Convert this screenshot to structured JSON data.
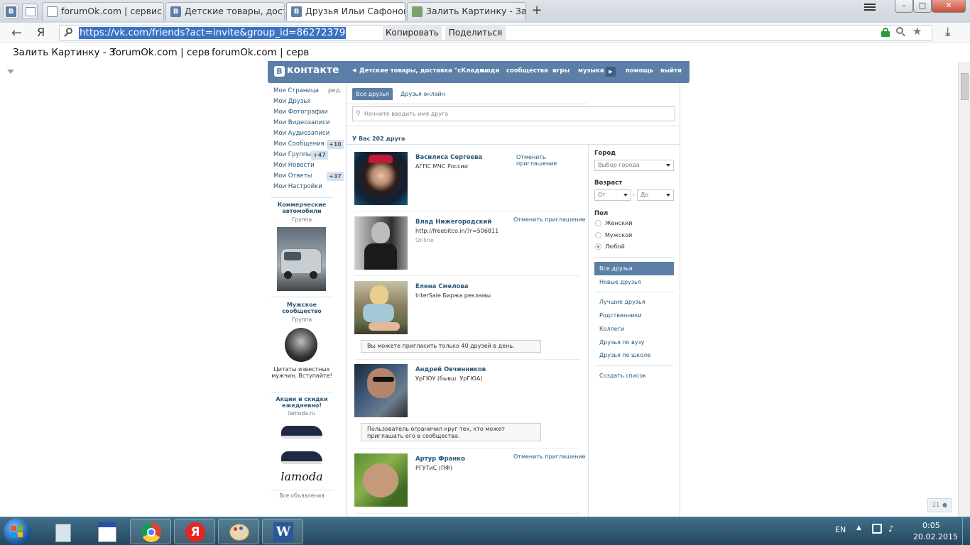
{
  "browser": {
    "tabs": [
      {
        "label": "forumOk.com | сервис",
        "active": false,
        "favicon": "doc"
      },
      {
        "label": "Детские товары, доставк",
        "active": false,
        "favicon": "vk"
      },
      {
        "label": "Друзья Ильи Сафонова",
        "active": true,
        "favicon": "vk"
      },
      {
        "label": "Залить Картинку - За",
        "active": false,
        "favicon": "img"
      }
    ],
    "pinned_tab_icons": [
      "vk-icon",
      "ru-icon"
    ],
    "new_tab_label": "+",
    "window_controls": {
      "minimize": "–",
      "maximize": "□",
      "close": "✕"
    },
    "yandex_label": "Я",
    "url": "https://vk.com/friends?act=invite&group_id=86272379",
    "copy_button": "Копировать",
    "share_button": "Поделиться",
    "bookmarks": [
      "Залить Картинку - З",
      "forumOk.com | серв",
      "forumOk.com | серв"
    ]
  },
  "vk": {
    "logo_letter": "В",
    "logo_text": "контакте",
    "nav": {
      "group": "Детские товары, доставка \"сКлади...",
      "people": "люди",
      "communities": "сообщества",
      "games": "игры",
      "music": "музыка",
      "help": "помощь",
      "logout": "выйти"
    },
    "left_menu": [
      {
        "label": "Моя Страница",
        "extra": "ред."
      },
      {
        "label": "Мои Друзья",
        "extra": ""
      },
      {
        "label": "Мои Фотографии",
        "extra": ""
      },
      {
        "label": "Мои Видеозаписи",
        "extra": ""
      },
      {
        "label": "Мои Аудиозаписи",
        "extra": ""
      },
      {
        "label": "Мои Сообщения",
        "extra": "+10"
      },
      {
        "label": "Мои Группы",
        "extra": "+47"
      },
      {
        "label": "Мои Новости",
        "extra": ""
      },
      {
        "label": "Мои Ответы",
        "extra": "+37"
      },
      {
        "label": "Мои Настройки",
        "extra": ""
      }
    ],
    "ads": [
      {
        "title": "Коммерческие автомобили",
        "sub": "Группа"
      },
      {
        "title": "Мужское сообщество",
        "sub": "Группа",
        "text": "Цитаты известных мужчин. Вступайте!"
      },
      {
        "title": "Акции и скидки ежедневно!",
        "sub": "lamoda.ru",
        "brand": "lamoda"
      }
    ],
    "all_ads": "Все объявления",
    "tabs": [
      "Все друзья",
      "Друзья онлайн"
    ],
    "search_placeholder": "Начните вводить имя друга",
    "friends_count": "У Вас 202 друга",
    "friends": [
      {
        "name": "Василиса Сергеева",
        "sub": "АГПС МЧС России",
        "status": "",
        "action": "Отменить приглашение",
        "note": ""
      },
      {
        "name": "Влад Нижегородский",
        "sub": "http://freebitco.in/?r=506811",
        "status": "Online",
        "action": "Отменить приглашение",
        "note": ""
      },
      {
        "name": "Елена Смелова",
        "sub": "InterSale Биржа рекламы",
        "status": "",
        "action": "",
        "note": "Вы можете пригласить только 40 друзей в день."
      },
      {
        "name": "Андрей Овчинников",
        "sub": "УрГЮУ (бывш. УрГЮА)",
        "status": "",
        "action": "",
        "note": "Пользователь ограничил круг тех, кто может приглашать его в сообщества."
      },
      {
        "name": "Артур Франко",
        "sub": "РГУТиС (ПФ)",
        "status": "",
        "action": "Отменить приглашение",
        "note": ""
      }
    ],
    "filters": {
      "city_label": "Город",
      "city_select": "Выбор города",
      "age_label": "Возраст",
      "age_from": "От",
      "age_dash": "-",
      "age_to": "До",
      "gender_label": "Пол",
      "genders": [
        "Женский",
        "Мужской",
        "Любой"
      ],
      "gender_selected": 2
    },
    "side_links": [
      "Все друзья",
      "Новые друзья",
      "Лучшие друзья",
      "Родственники",
      "Коллеги",
      "Друзья по вузу",
      "Друзья по школе",
      "Создать список"
    ],
    "corner_counter": "21"
  },
  "taskbar": {
    "lang": "EN",
    "time": "0:05",
    "date": "20.02.2015",
    "apps": [
      "start-button",
      "calculator-icon",
      "notepad-icon",
      "chrome-icon",
      "yandex-icon",
      "paint-icon",
      "word-icon"
    ]
  },
  "colors": {
    "vk_blue": "#5b7fa6",
    "link": "#2b587a",
    "selection": "#3b73c4"
  }
}
